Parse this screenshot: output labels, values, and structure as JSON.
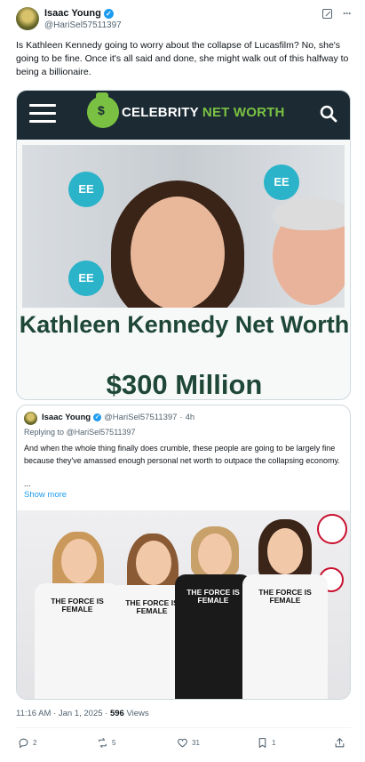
{
  "author": {
    "name": "Isaac Young",
    "handle": "@HariSel57511397"
  },
  "tweet_text": "Is Kathleen Kennedy going to worry about the collapse of Lucasfilm? No, she's going to be fine. Once it's all said and done, she might walk out of this halfway to being a billionaire.",
  "card": {
    "brand_word1": "CELEBRITY",
    "brand_word2": "NET WORTH",
    "headline": "Kathleen Kennedy Net Worth",
    "amount": "$300 Million",
    "ee_label": "EE"
  },
  "quote": {
    "name": "Isaac Young",
    "handle": "@HariSel57511397",
    "dot": "·",
    "time": "4h",
    "replying": "Replying to @HariSel57511397",
    "text": "And when the whole thing finally does crumble, these people are going to be largely fine because they've amassed enough personal net worth to outpace the collapsing economy.",
    "ellipsis": "...",
    "show_more": "Show more",
    "shirt_text": "THE FORCE IS FEMALE"
  },
  "meta": {
    "time_date": "11:16 AM · Jan 1, 2025 · ",
    "views_count": "596",
    "views_label": " Views"
  },
  "actions": {
    "replies": "2",
    "reposts": "5",
    "likes": "31",
    "bookmarks": "1"
  },
  "colors": {
    "brand_green": "#7ac143",
    "navy": "#1b2a33",
    "headline_green": "#1e4737",
    "link_blue": "#1d9bf0"
  }
}
